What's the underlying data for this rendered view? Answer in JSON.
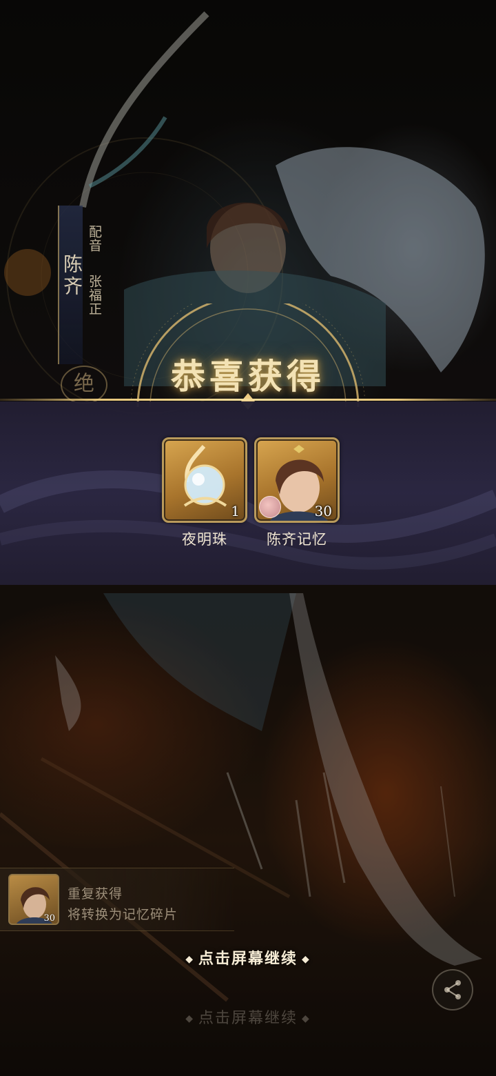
{
  "character": {
    "name": "陈齐",
    "voice_label": "配音",
    "voice_actor": "张福正",
    "rarity": "绝"
  },
  "reward_panel": {
    "title": "恭喜获得",
    "items": [
      {
        "label": "夜明珠",
        "count": "1",
        "icon": "pearl-icon"
      },
      {
        "label": "陈齐记忆",
        "count": "30",
        "icon": "character-portrait"
      }
    ]
  },
  "duplicate_notice": {
    "line1": "重复获得",
    "line2": "将转换为记忆碎片",
    "count": "30"
  },
  "continue_prompt": "点击屏幕继续",
  "continue_prompt_faded": "点击屏幕继续",
  "colors": {
    "gold": "#e7c77c",
    "band": "#2c2844",
    "text_light": "#f0e6d2"
  }
}
